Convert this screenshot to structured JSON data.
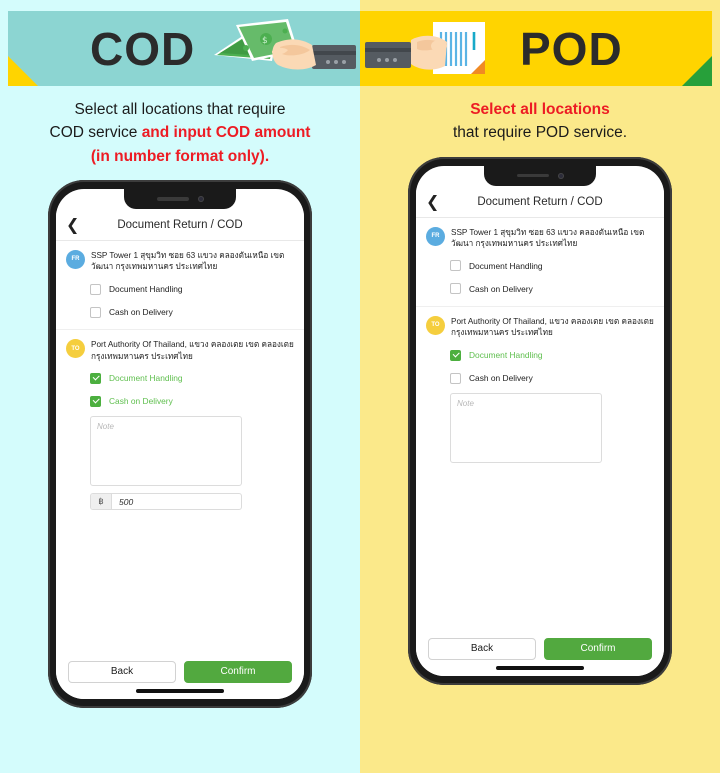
{
  "panels": [
    {
      "id": "cod",
      "banner": {
        "title": "COD",
        "bg_color": "#8CD5D2",
        "corner_triangle_color": "#FFD400",
        "artwork": "hand-holding-money-icon"
      },
      "instruction": {
        "line1_plain": "Select all locations that require",
        "line2_plain": "COD service ",
        "line2_highlight": "and input COD amount",
        "line3_highlight": "(in number format only)."
      },
      "bg_color": "#D4FCFC",
      "phone": {
        "appbar": {
          "back_icon": "chevron-left-icon",
          "title": "Document Return / COD"
        },
        "locations": [
          {
            "badge": "FR",
            "badge_color": "#5BACE0",
            "address": "SSP Tower 1 สุขุมวิท ซอย 63 แขวง คลองตันเหนือ เขตวัฒนา กรุงเทพมหานคร ประเทศไทย",
            "options": [
              {
                "label": "Document Handling",
                "checked": false
              },
              {
                "label": "Cash on Delivery",
                "checked": false
              }
            ]
          },
          {
            "badge": "TO",
            "badge_color": "#F5CE3E",
            "address": "Port Authority Of Thailand, แขวง คลองเตย เขต คลองเตย กรุงเทพมหานคร ประเทศไทย",
            "options": [
              {
                "label": "Document Handling",
                "checked": true
              },
              {
                "label": "Cash on Delivery",
                "checked": true
              }
            ],
            "note_placeholder": "Note",
            "amount": {
              "currency_symbol": "฿",
              "value": "500"
            }
          }
        ],
        "footer": {
          "back_label": "Back",
          "confirm_label": "Confirm",
          "confirm_color": "#52A93F"
        }
      }
    },
    {
      "id": "pod",
      "banner": {
        "title": "POD",
        "bg_color": "#FFD400",
        "corner_triangle_color": "#27A03A",
        "artwork": "hand-holding-document-icon"
      },
      "instruction": {
        "line1_highlight": "Select all locations",
        "line2_plain": "that require POD service."
      },
      "bg_color": "#FBE98A",
      "phone": {
        "appbar": {
          "back_icon": "chevron-left-icon",
          "title": "Document Return / COD"
        },
        "locations": [
          {
            "badge": "FR",
            "badge_color": "#5BACE0",
            "address": "SSP Tower 1 สุขุมวิท ซอย 63 แขวง คลองตันเหนือ เขตวัฒนา กรุงเทพมหานคร ประเทศไทย",
            "options": [
              {
                "label": "Document Handling",
                "checked": false
              },
              {
                "label": "Cash on Delivery",
                "checked": false
              }
            ]
          },
          {
            "badge": "TO",
            "badge_color": "#F5CE3E",
            "address": "Port Authority Of Thailand, แขวง คลองเตย เขต คลองเตย กรุงเทพมหานคร ประเทศไทย",
            "options": [
              {
                "label": "Document Handling",
                "checked": true
              },
              {
                "label": "Cash on Delivery",
                "checked": false
              }
            ],
            "note_placeholder": "Note"
          }
        ],
        "footer": {
          "back_label": "Back",
          "confirm_label": "Confirm",
          "confirm_color": "#52A93F"
        }
      }
    }
  ],
  "colors": {
    "highlight_red": "#ED1C24",
    "checked_green": "#4CAF3F",
    "label_green": "#5FBF4E"
  }
}
